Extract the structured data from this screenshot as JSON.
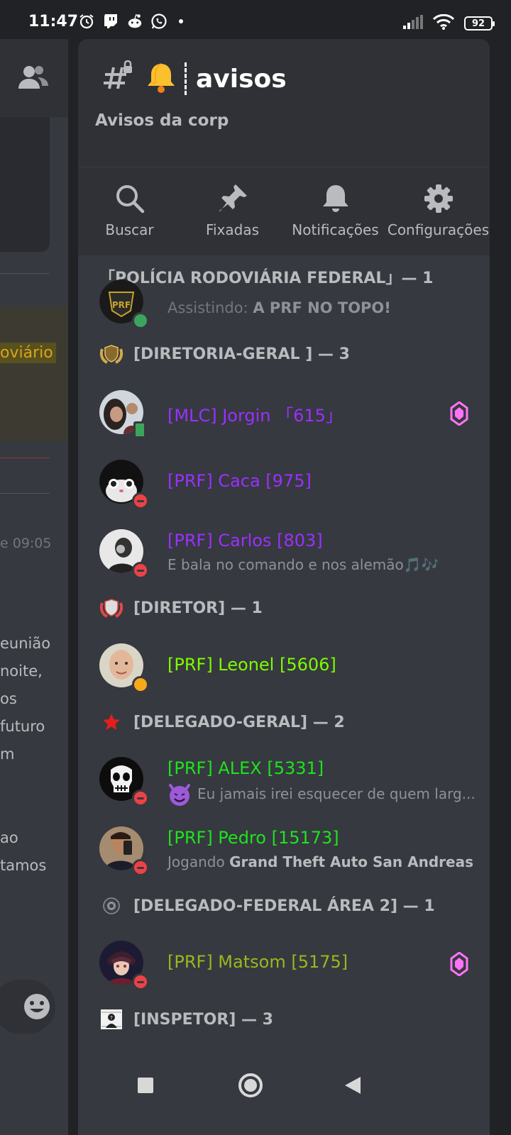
{
  "status_bar": {
    "time": "11:47",
    "battery": "92"
  },
  "left_pane": {
    "gold_text": "oviário",
    "timestamp": "e 09:05",
    "lines": [
      "eunião",
      "noite,",
      "os",
      "futuro",
      "m",
      "ao",
      "tamos"
    ]
  },
  "channel": {
    "name": "avisos",
    "topic": "Avisos da corp"
  },
  "toolbar": [
    {
      "label": "Buscar",
      "icon": "search-icon"
    },
    {
      "label": "Fixadas",
      "icon": "pin-icon"
    },
    {
      "label": "Notificações",
      "icon": "bell-icon"
    },
    {
      "label": "Configurações",
      "icon": "gear-icon"
    }
  ],
  "categories": [
    {
      "label": "「POLÍCIA RODOVIÁRIA FEDERAL」— 1"
    },
    {
      "label": "[DIRETORIA-GERAL ] — 3"
    },
    {
      "label": "[DIRETOR] — 1"
    },
    {
      "label": "[DELEGADO-GERAL] — 2"
    },
    {
      "label": "[DELEGADO-FEDERAL ÁREA 2] — 1"
    },
    {
      "label": "[INSPETOR] — 3"
    }
  ],
  "members": [
    {
      "activity_prefix": "Assistindo: ",
      "activity_bold": "A PRF NO TOPO!"
    },
    {
      "name": "[MLC]   Jorgin 「615」",
      "color": "#9b30ff"
    },
    {
      "name": "[PRF] Caca [975]",
      "color": "#9b30ff"
    },
    {
      "name": "[PRF] Carlos [803]",
      "color": "#9b30ff",
      "activity": "E bala no comando e nos alemão🎵🎶"
    },
    {
      "name": "[PRF] Leonel [5606]",
      "color": "#7cfc00"
    },
    {
      "name": "[PRF] ALEX [5331]",
      "color": "#1ee31e",
      "activity": "Eu jamais irei esquecer de quem larg..."
    },
    {
      "name": "[PRF] Pedro [15173]",
      "color": "#1ee31e",
      "activity_prefix": "Jogando ",
      "activity_bold": "Grand Theft Auto San Andreas"
    },
    {
      "name": "[PRF] Matsom [5175]",
      "color": "#9ab81f"
    }
  ],
  "colors": {
    "boost": "#ff73fa",
    "background": "#36393f",
    "header": "#2f3136"
  }
}
